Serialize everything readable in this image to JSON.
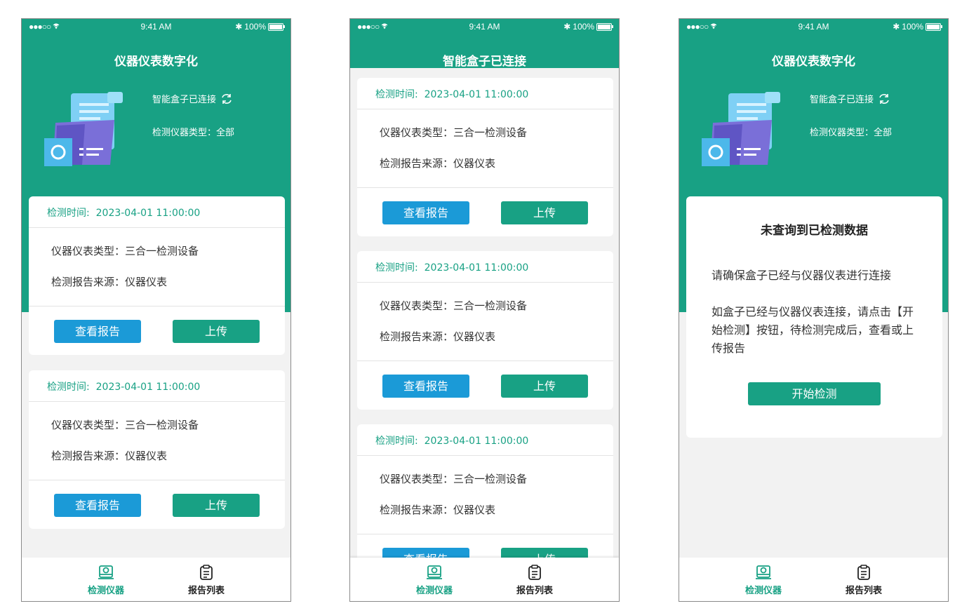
{
  "status_bar": {
    "signal": "●●●○○",
    "time": "9:41 AM",
    "battery": "100%"
  },
  "home": {
    "title": "仪器仪表数字化",
    "connection_status": "智能盒子已连接",
    "instrument_type_line": "检测仪器类型：全部"
  },
  "list_screen": {
    "title": "智能盒子已连接"
  },
  "record": {
    "time_label": "检测时间:",
    "time_value": "2023-04-01   11:00:00",
    "type_line": "仪器仪表类型：三合一检测设备",
    "source_line": "检测报告来源：仪器仪表",
    "view_button": "查看报告",
    "upload_button": "上传"
  },
  "empty_state": {
    "title": "未查询到已检测数据",
    "line1": "请确保盒子已经与仪器仪表进行连接",
    "line2": "如盒子已经与仪器仪表连接，请点击【开始检测】按钮，待检测完成后，查看或上传报告",
    "start_button": "开始检测"
  },
  "tabs": [
    {
      "label": "检测仪器",
      "icon": "instrument-icon"
    },
    {
      "label": "报告列表",
      "icon": "clipboard-icon"
    }
  ],
  "colors": {
    "primary": "#18a184",
    "blue": "#1b9ad7",
    "background": "#f2f2f2"
  }
}
